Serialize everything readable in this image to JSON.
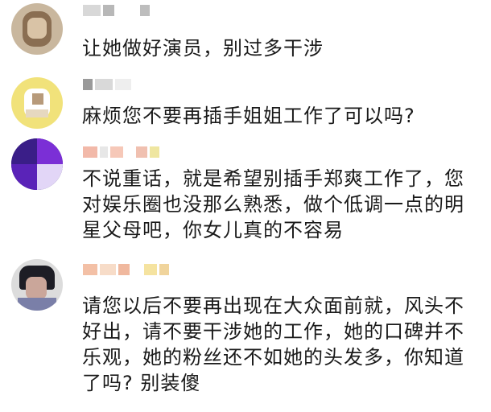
{
  "comments": [
    {
      "avatar": "blurred-profile-photo",
      "text": "让她做好演员，别过多干涉"
    },
    {
      "avatar": "blurred-profile-photo",
      "text": "麻烦您不要再插手姐姐工作了可以吗?"
    },
    {
      "avatar": "blurred-profile-photo",
      "text": "不说重话，就是希望别插手郑爽工作了，您\n对娱乐圈也没那么熟悉，做个低调一点的明\n星父母吧，你女儿真的不容易"
    },
    {
      "avatar": "blurred-profile-photo",
      "text": "请您以后不要再出现在大众面前就，风头不\n好出，请不要干涉她的工作，她的口碑并不\n乐观，她的粉丝还不如她的头发多，你知道\n了吗? 别装傻"
    }
  ]
}
